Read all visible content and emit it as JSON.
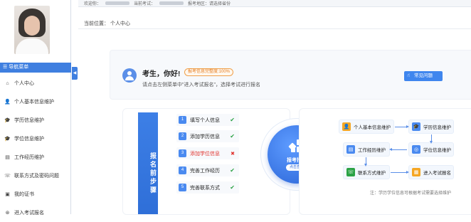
{
  "sidebar": {
    "menu_header": "☰ 导航菜单",
    "collapse": "◀",
    "items": [
      {
        "label": "个人中心",
        "icon": "home-icon",
        "glyph": "⌂"
      },
      {
        "label": "个人基本信息维护",
        "icon": "user-icon",
        "glyph": "👤"
      },
      {
        "label": "学历信息维护",
        "icon": "graduation-icon",
        "glyph": "🎓"
      },
      {
        "label": "学位信息维护",
        "icon": "degree-icon",
        "glyph": "🎓"
      },
      {
        "label": "工作经历维护",
        "icon": "briefcase-icon",
        "glyph": "▤"
      },
      {
        "label": "联系方式及密码问题",
        "icon": "phone-icon",
        "glyph": "☏"
      },
      {
        "label": "我的证书",
        "icon": "certificate-icon",
        "glyph": "▣"
      },
      {
        "label": "进入考试报名",
        "icon": "enter-icon",
        "glyph": "⊛"
      }
    ]
  },
  "topbar": {
    "welcome": "欢迎你：",
    "exam_label": "当前考试：",
    "region_label": "报考地区：请选择省份"
  },
  "breadcrumb": "当前位置：  个人中心",
  "welcome_card": {
    "greeting": "考生，你好!",
    "completeness": "报考信息完整度:100%",
    "hint": "请点击左侧菜单中\"进入考试报名\"，选择考试进行报名",
    "faq_button": "常见问题"
  },
  "steps": {
    "title": "报名前步骤",
    "items": [
      {
        "num": "1",
        "label": "填写个人信息",
        "status": "✔",
        "warn": false
      },
      {
        "num": "2",
        "label": "添加学历信息",
        "status": "✔",
        "warn": false
      },
      {
        "num": "3",
        "label": "添加学位信息",
        "status": "✖",
        "warn": true
      },
      {
        "num": "4",
        "label": "完善工作经历",
        "status": "✔",
        "warn": false
      },
      {
        "num": "5",
        "label": "完善联系方式",
        "status": "✔",
        "warn": false
      }
    ]
  },
  "center": {
    "title": "报考指南",
    "sub": "点击查看"
  },
  "flow": {
    "boxes": [
      {
        "label": "个人基本信息维护",
        "icon": "user-icon",
        "color": "#f5a623",
        "glyph": "👤"
      },
      {
        "label": "学历信息维护",
        "icon": "graduation-icon",
        "color": "#4a8af0",
        "glyph": "🎓"
      },
      {
        "label": "学位信息维护",
        "icon": "degree-icon",
        "color": "#4a8af0",
        "glyph": "◎"
      },
      {
        "label": "工作经历维护",
        "icon": "briefcase-icon",
        "color": "#4a8af0",
        "glyph": "▤"
      },
      {
        "label": "联系方式维护",
        "icon": "phone-icon",
        "color": "#2ba245",
        "glyph": "☏"
      },
      {
        "label": "进入考试报名",
        "icon": "enter-icon",
        "color": "#f5a623",
        "glyph": "▦"
      }
    ],
    "note": "注：学历学位信息可根据考试需要选择维护"
  }
}
